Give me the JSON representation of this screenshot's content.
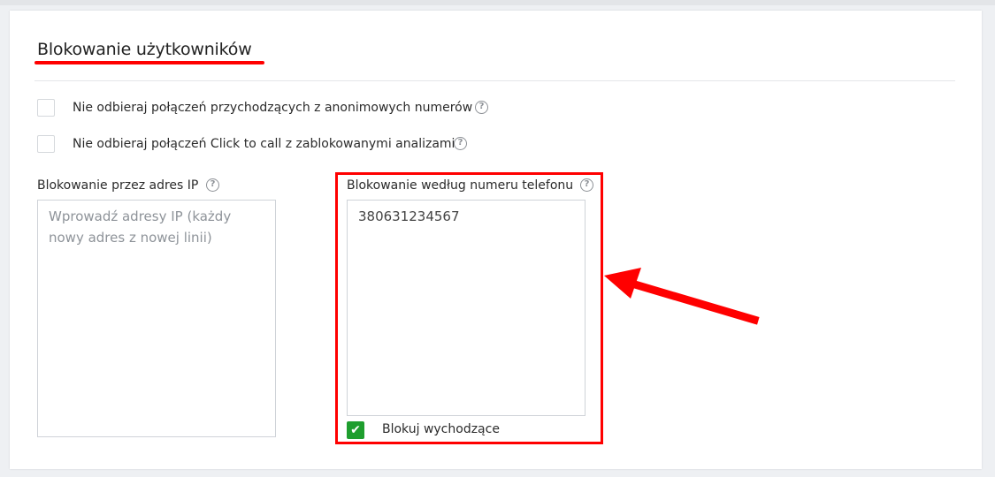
{
  "section": {
    "title": "Blokowanie użytkowników"
  },
  "options": [
    {
      "label": "Nie odbieraj połączeń przychodzących z anonimowych numerów",
      "checked": false,
      "help_icon": "question-circle-icon"
    },
    {
      "label": "Nie odbieraj połączeń Click to call z zablokowanymi analizami",
      "checked": false,
      "help_icon": "question-circle-icon"
    }
  ],
  "ip_block": {
    "label": "Blokowanie przez adres IP",
    "placeholder": "Wprowadź adresy IP (każdy nowy adres z nowej linii)",
    "value": "",
    "help_icon": "question-circle-icon"
  },
  "phone_block": {
    "label": "Blokowanie według numeru telefonu",
    "value": "380631234567",
    "help_icon": "question-circle-icon",
    "outgoing": {
      "label": "Blokuj wychodzące",
      "checked": true
    }
  },
  "help_glyph": "?",
  "check_glyph": "✔",
  "colors": {
    "accent_red": "#ff0000",
    "checkbox_green": "#1e9e2e",
    "card_bg": "#ffffff",
    "page_bg": "#eef0f3"
  }
}
